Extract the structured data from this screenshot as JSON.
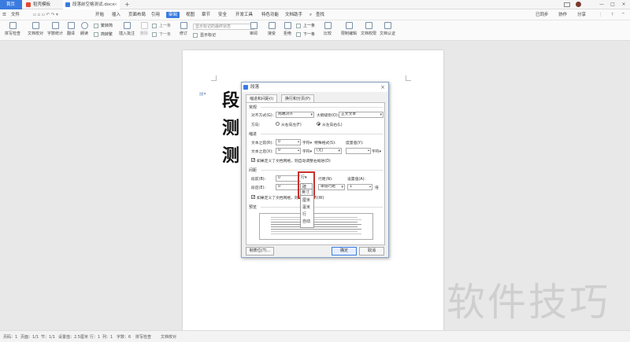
{
  "tabs": [
    {
      "label": "首页"
    },
    {
      "label": "稻壳模板"
    },
    {
      "label": "段落前空格测试.docx"
    }
  ],
  "menu": {
    "file": "文件",
    "items": [
      "开始",
      "插入",
      "页面布局",
      "引用",
      "审阅",
      "视图",
      "章节",
      "安全",
      "开发工具",
      "特色功能",
      "文档助手"
    ],
    "active_index": 4,
    "search": "查找",
    "right": [
      "已同步",
      "协作",
      "分享"
    ]
  },
  "ribbon": {
    "spellcheck": "拼写检查",
    "doc_check": "文档校对",
    "word_count": "字数统计",
    "translate": "翻译",
    "read": "朗读",
    "simp_to_trad": "繁转简",
    "trad_to_simp": "简转繁",
    "insert_comment": "插入批注",
    "delete": "删除",
    "prev": "上一条",
    "next": "下一条",
    "revise": "修订",
    "display_select": "显示标记的最终状态",
    "show_marks": "显示标记",
    "review": "审阅",
    "accept": "接受",
    "reject": "拒绝",
    "prev2": "上一条",
    "next2": "下一条",
    "compare": "比较",
    "restrict_edit": "限制编辑",
    "doc_permission": "文档权限",
    "doc_cert": "文档认证"
  },
  "document": {
    "lines": [
      "段",
      "测",
      "测"
    ]
  },
  "watermark": "软件技巧",
  "statusbar": {
    "page_num": "页码：1",
    "pages": "页面：1/1",
    "section": "节：1/1",
    "setting": "设置值：2.5厘米",
    "row": "行：1",
    "col": "列：1",
    "words": "字数：6",
    "spell": "拼写检查",
    "doc_check": "文档校对"
  },
  "dialog": {
    "title": "段落",
    "close": "×",
    "tab_indent": "缩进和间距(I)",
    "tab_break": "换行和分页(P)",
    "general": "常规",
    "align_label": "对齐方式(G):",
    "align_value": "两端对齐",
    "outline_label": "大纲级别(O):",
    "outline_value": "正文文本",
    "direction_label": "方向:",
    "rtl": "从右向左(F)",
    "ltr": "从左向右(L)",
    "indent": "缩进",
    "before_text_label": "文本之前(R):",
    "before_text_value": "0",
    "before_unit": "字符▾",
    "special_label": "特殊格式(S):",
    "measure_label": "度量值(Y):",
    "after_text_label": "文本之后(X):",
    "after_text_value": "0",
    "after_unit": "字符▾",
    "special_value": "(无)",
    "measure_unit": "字符▾",
    "auto_indent": "如果定义了文档网格，则自动调整右缩进(D)",
    "spacing": "间距",
    "before_label": "段前(B):",
    "before_value": "0",
    "after_label": "段后(E):",
    "after_value": "0",
    "line_spacing_label": "行距(N):",
    "line_spacing_value": "单倍行距",
    "set_value_label": "设置值(A):",
    "set_value": "1",
    "times": "倍",
    "snap_grid": "如果定义了文档网格，则与网格对齐(W)",
    "preview": "预览",
    "tabs_btn": "制表位(T)...",
    "ok": "确定",
    "cancel": "取消",
    "unit_current": "行▾",
    "unit_options": [
      "磅",
      "英寸",
      "厘米",
      "毫米",
      "行",
      "自动"
    ]
  }
}
